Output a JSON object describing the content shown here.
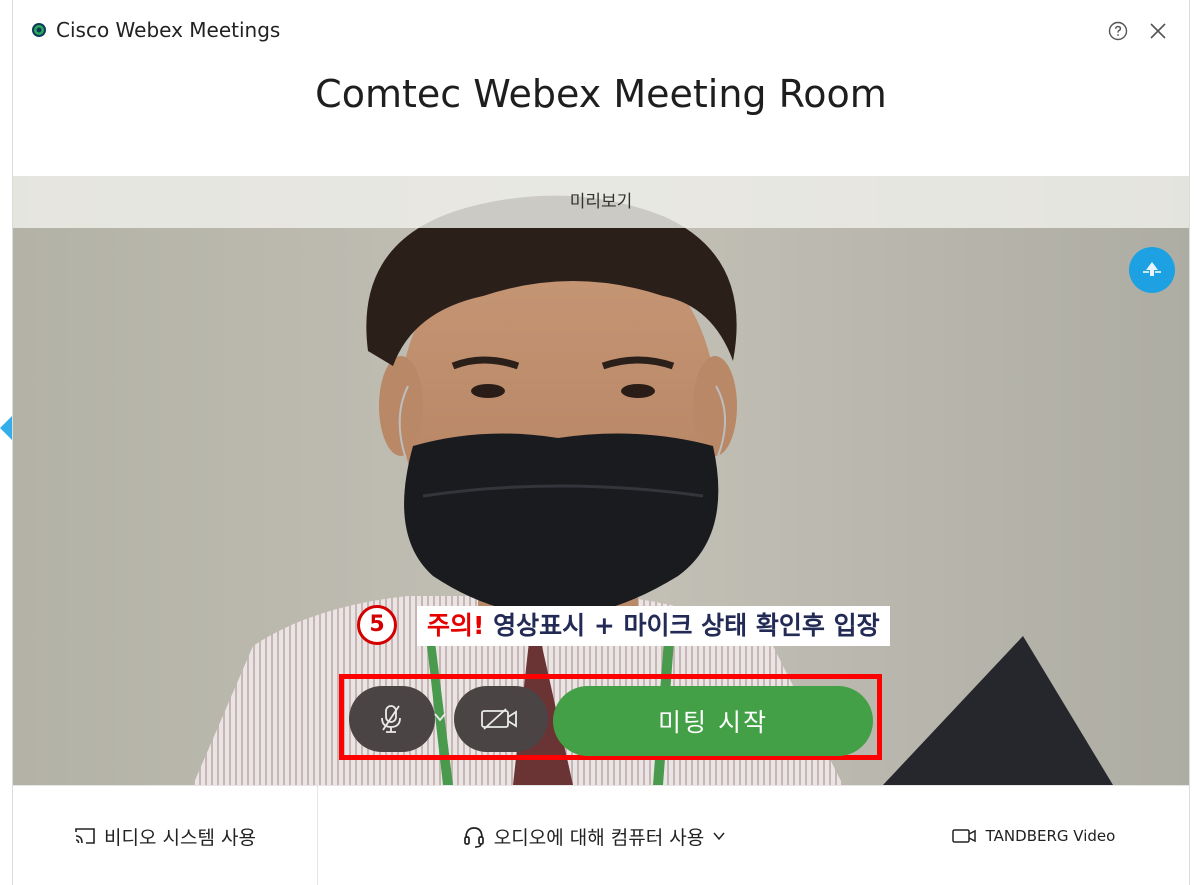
{
  "window": {
    "app_title": "Cisco Webex Meetings",
    "meeting_title": "Comtec Webex Meeting Room"
  },
  "preview": {
    "label": "미리보기"
  },
  "notice": {
    "step_number": "5",
    "warning": "주의!",
    "text": " 영상표시 + 마이크 상태 확인후 입장"
  },
  "controls": {
    "start_meeting_label": "미팅 시작"
  },
  "bottom_options": {
    "video_system": "비디오 시스템 사용",
    "audio": "오디오에 대해 컴퓨터 사용",
    "camera": "TANDBERG Video"
  },
  "colors": {
    "start_button": "#43a047",
    "highlight_border": "#ff0000",
    "pip_button": "#1da1e2",
    "warning_text": "#e60000"
  },
  "icons": {
    "app": "webex-logo-icon",
    "help": "help-circle-icon",
    "close": "close-icon",
    "pip": "pip-icon",
    "mic": "mic-muted-icon",
    "camera": "video-off-icon",
    "cast": "cast-icon",
    "headset": "headset-icon",
    "video": "video-camera-icon"
  }
}
